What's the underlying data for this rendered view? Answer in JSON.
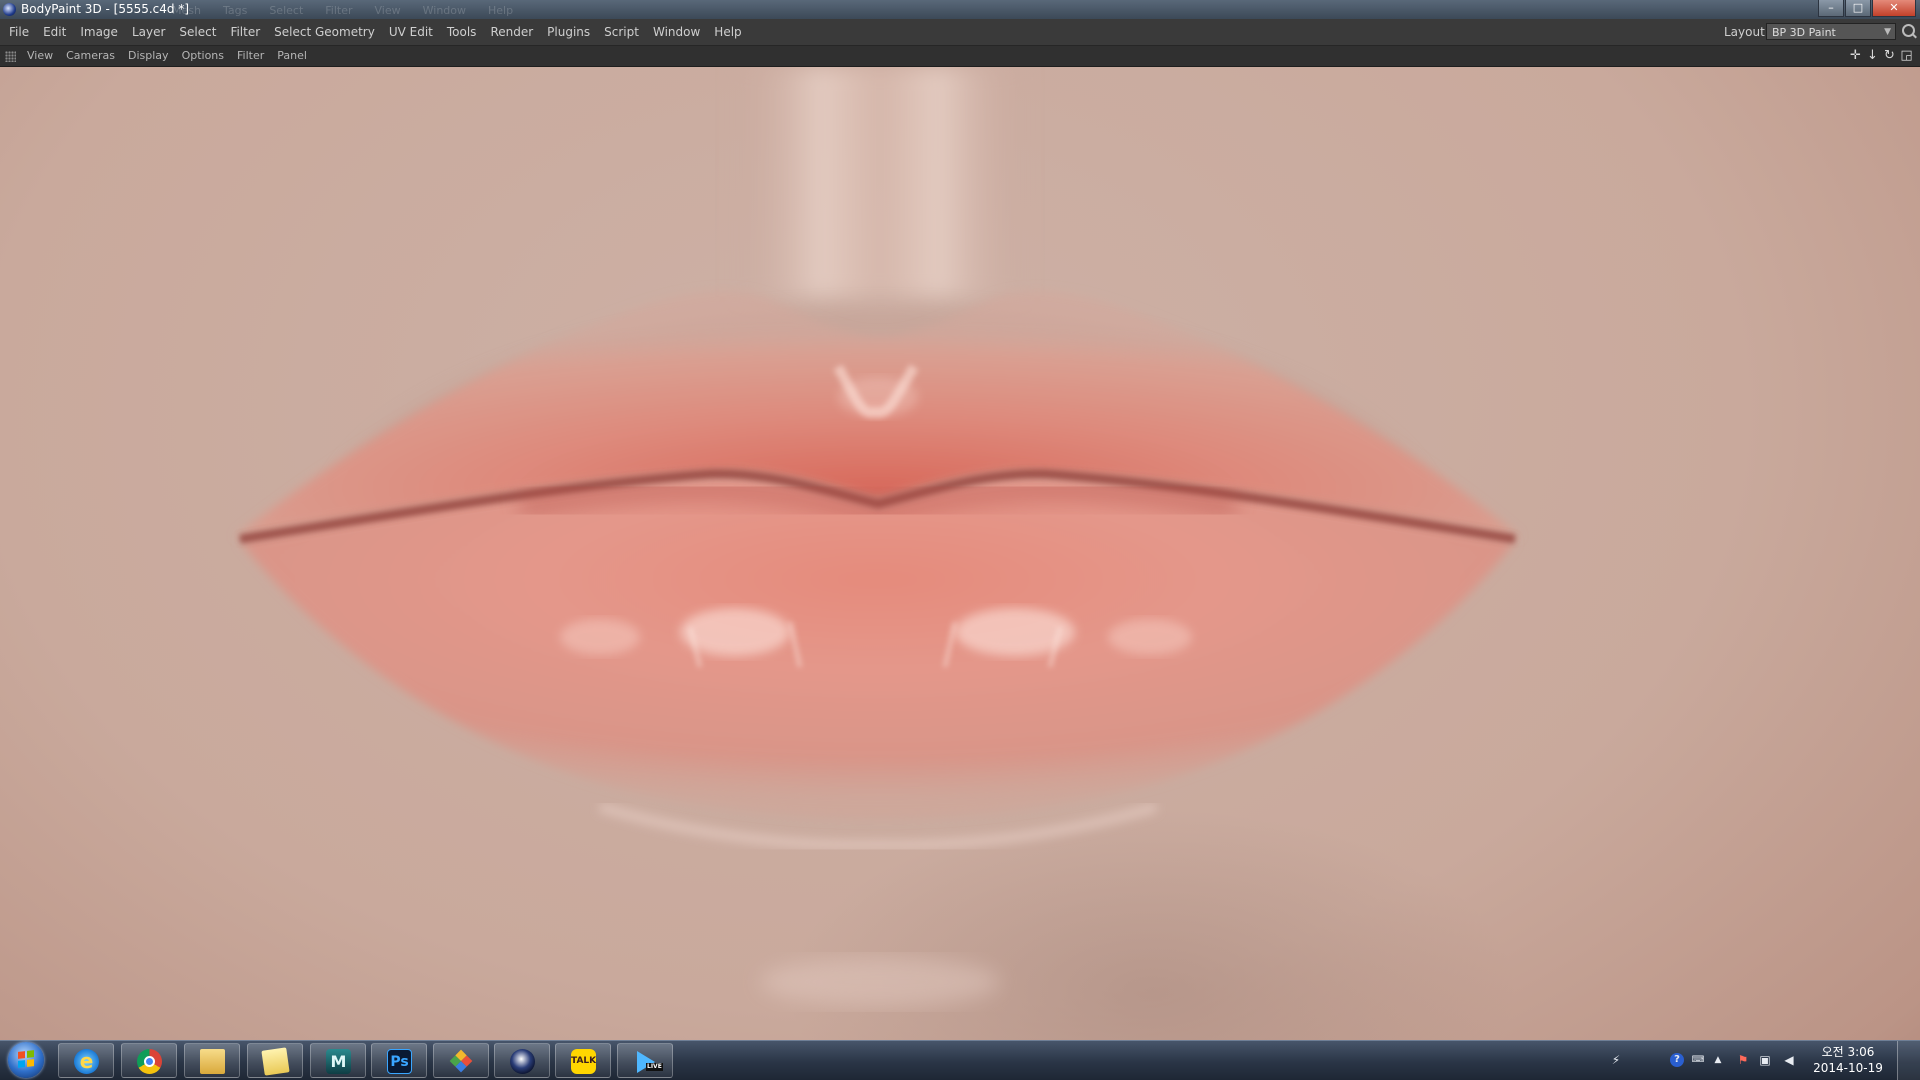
{
  "window": {
    "title": "BodyPaint 3D - [5555.c4d *]",
    "ghost_menu": [
      "Mesh",
      "Tags",
      "Select",
      "Filter",
      "View",
      "Window",
      "Help"
    ],
    "controls": [
      "minimize",
      "maximize",
      "close"
    ]
  },
  "menubar": {
    "items": [
      "File",
      "Edit",
      "Image",
      "Layer",
      "Select",
      "Filter",
      "Select Geometry",
      "UV Edit",
      "Tools",
      "Render",
      "Plugins",
      "Script",
      "Window",
      "Help"
    ],
    "layout_label": "Layout:",
    "layout_value": "BP 3D Paint"
  },
  "viewmenu": {
    "items": [
      "View",
      "Cameras",
      "Display",
      "Options",
      "Filter",
      "Panel"
    ],
    "nav_icons": [
      "move-icon",
      "zoom-icon",
      "rotate-icon",
      "toggle-view-icon"
    ]
  },
  "viewport": {
    "content": "painted-lips",
    "colors": {
      "skin": "#cbaea3",
      "lip": "#d98074",
      "lip_shadow": "#a84c45",
      "highlight": "#ffe6de"
    }
  },
  "taskbar": {
    "apps": [
      {
        "name": "internet-explorer-icon",
        "text": "e"
      },
      {
        "name": "chrome-icon",
        "text": ""
      },
      {
        "name": "file-explorer-icon",
        "text": ""
      },
      {
        "name": "folder-icon",
        "text": ""
      },
      {
        "name": "maya-icon",
        "text": "M"
      },
      {
        "name": "photoshop-icon",
        "text": "Ps"
      },
      {
        "name": "mosaic-app-icon",
        "text": ""
      },
      {
        "name": "cinema4d-icon",
        "text": ""
      },
      {
        "name": "kakaotalk-icon",
        "text": "TALK"
      },
      {
        "name": "windows-live-icon",
        "text": "LIVE"
      }
    ],
    "tray": [
      "network-icon",
      "help-icon",
      "keyboard-icon",
      "show-hidden-icon",
      "flag-icon",
      "monitor-icon",
      "volume-icon"
    ],
    "clock": {
      "time": "오전 3:06",
      "date": "2014-10-19"
    }
  }
}
